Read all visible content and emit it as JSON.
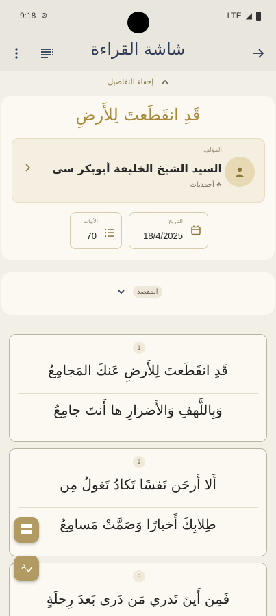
{
  "status": {
    "time": "9:18",
    "network": "LTE"
  },
  "appbar": {
    "title": "شاشة القراءة"
  },
  "details_toggle": {
    "label": "إخفاء التفاصيل"
  },
  "poem": {
    "title": "قَدِ انقَطَعتَ لِلأَرضِ",
    "author_label": "المؤلف",
    "author_name": "السيد الشيخ الخليفة أبوبكر سي",
    "author_sect": "أحمديات",
    "date_label": "التاريخ",
    "date_value": "18/4/2025",
    "verses_label": "الأبيات",
    "verses_value": "70"
  },
  "meter": {
    "label": "المقصد"
  },
  "verses": [
    {
      "num": "1",
      "a": "قَدِ انقَطَعتَ لِلأَرضِ عَنكَ المَجامِعُ",
      "b": "وَبِاللَّهفِ وَالأَضرارِ ها أَنتَ جامِعُ"
    },
    {
      "num": "2",
      "a": "أَلا أَرحَن نَفسًا تَكادُ تَغولُ مِن",
      "b": "طِلابِكَ أَخبارًا وَصَمَّتْ مَسامِعُ"
    },
    {
      "num": "3",
      "a": "فَمِن أَينَ تَدري مَن دَرى بَعدَ رِحلَةٍ",
      "b": ""
    }
  ],
  "colors": {
    "accent": "#b29b62",
    "title": "#a88a3a",
    "appbar_text": "#2e3b55"
  }
}
